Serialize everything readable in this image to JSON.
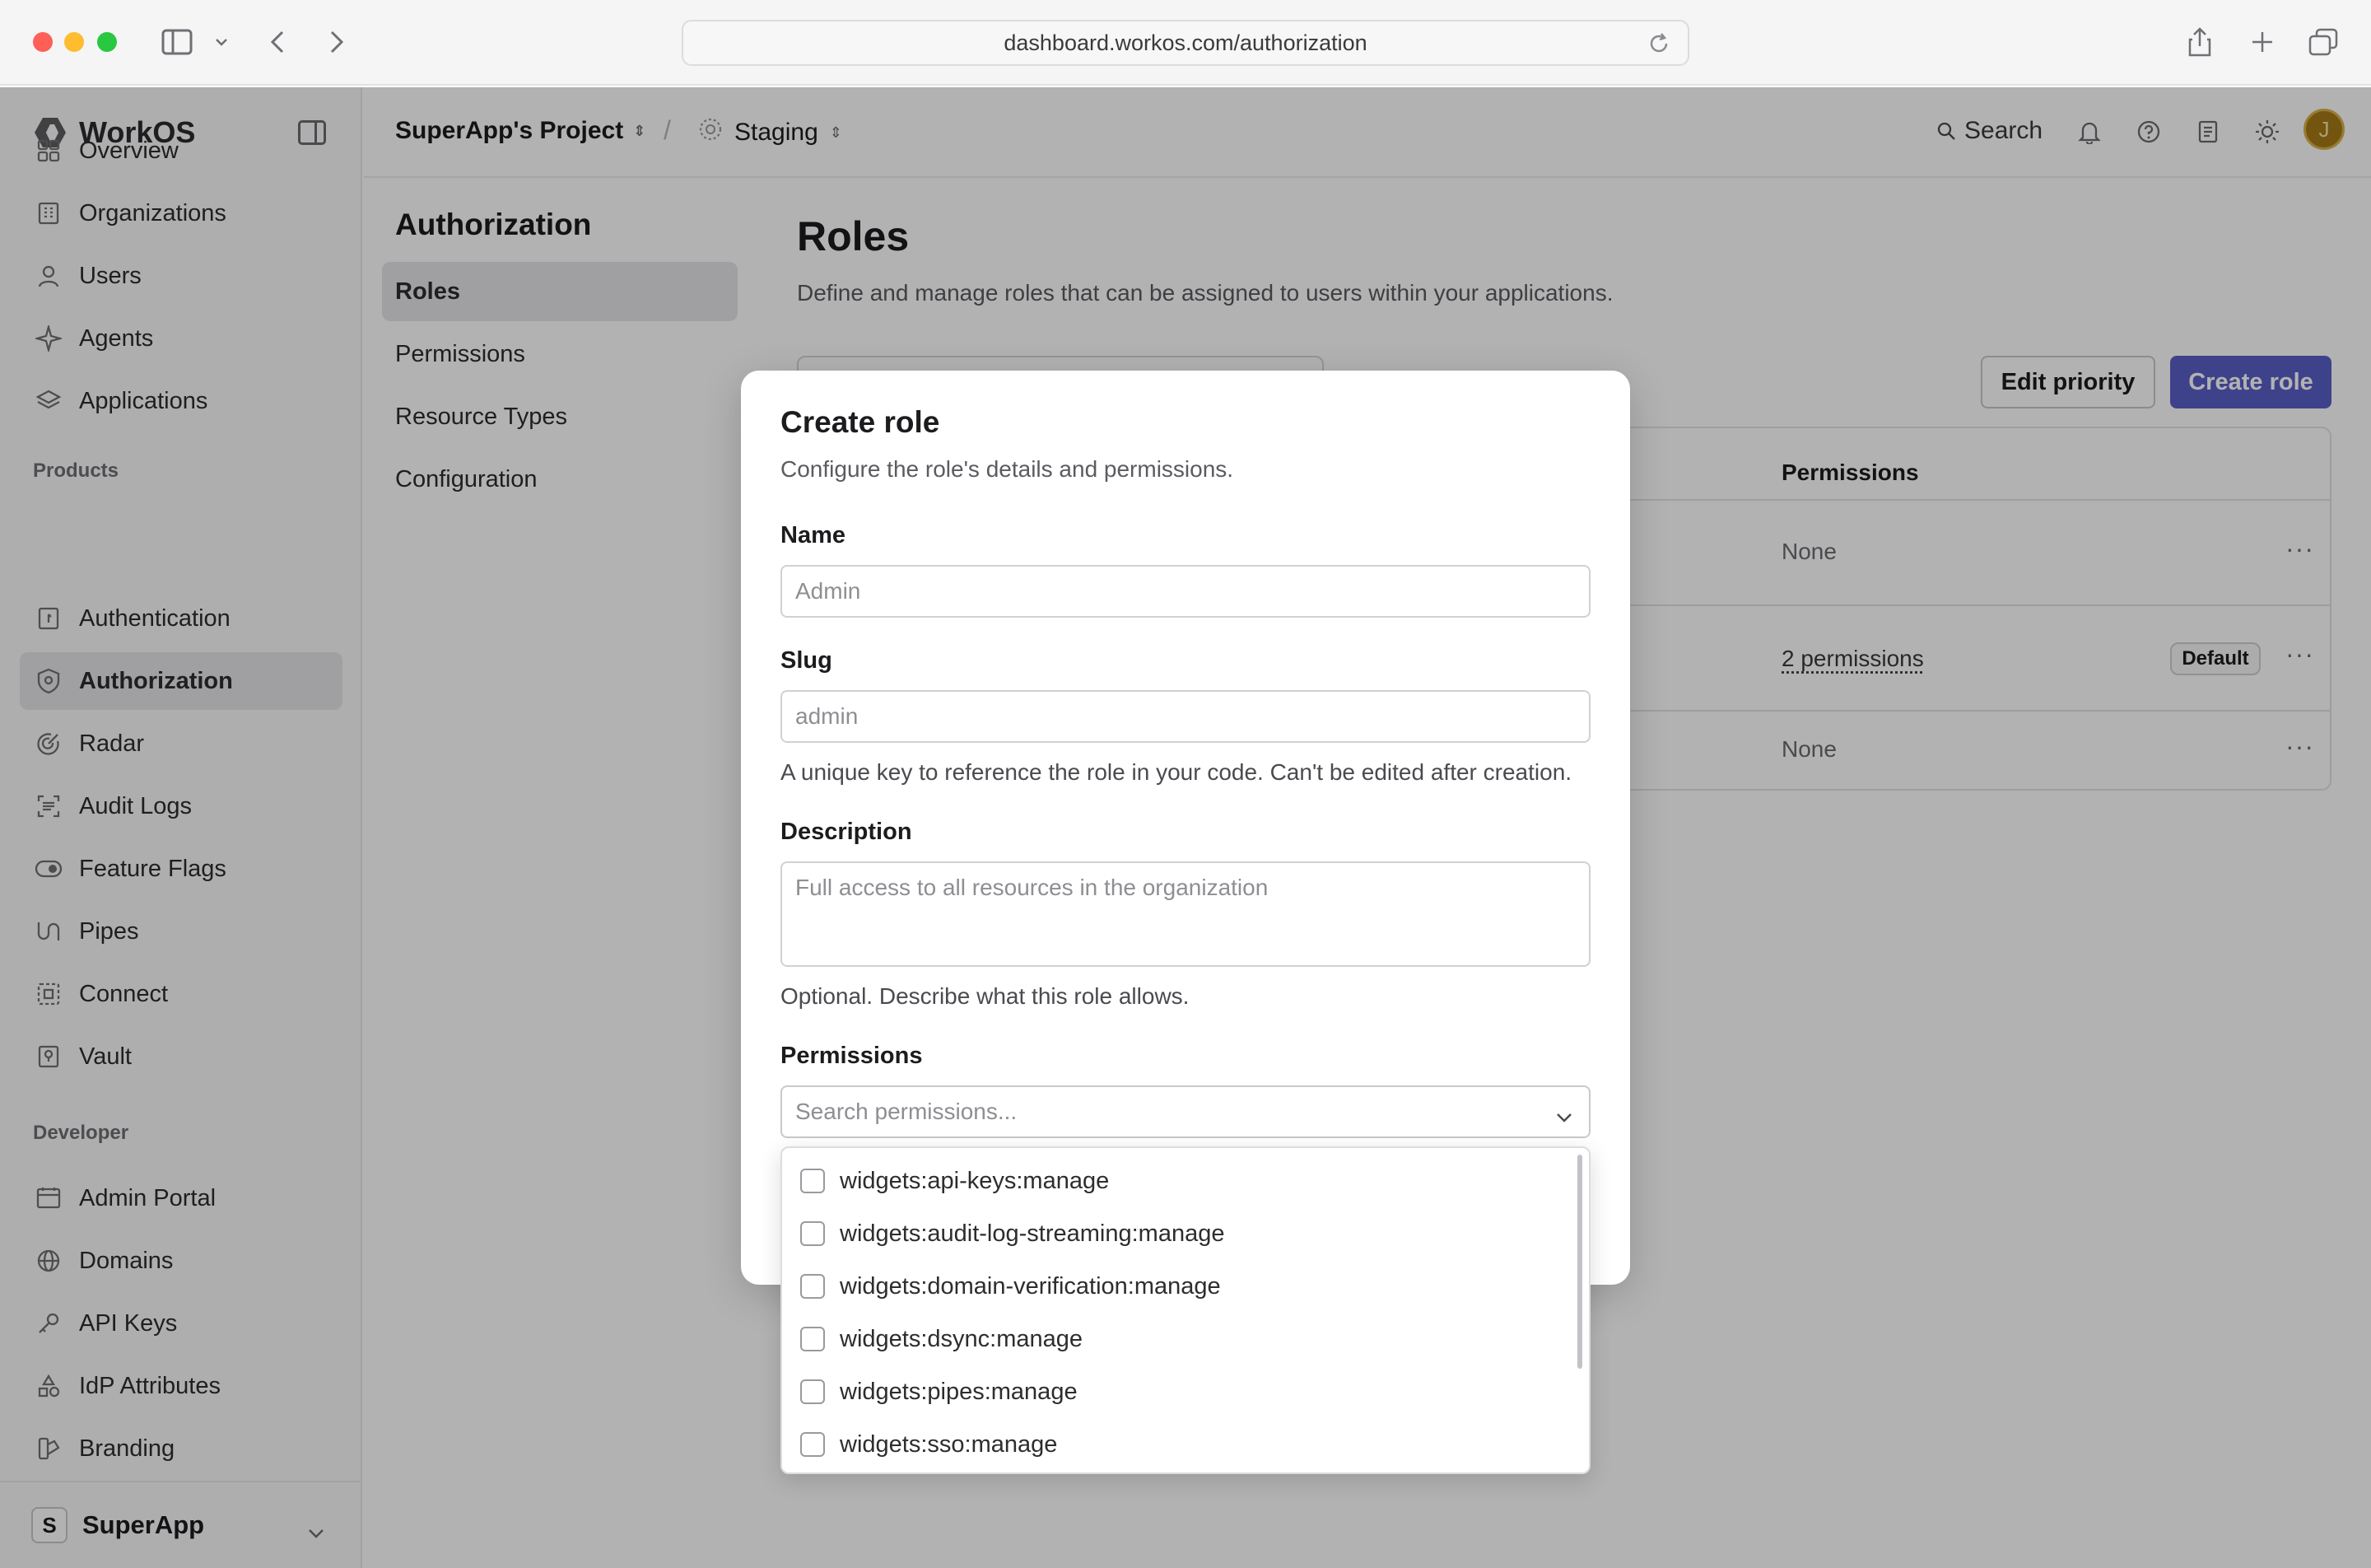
{
  "browser": {
    "url": "dashboard.workos.com/authorization"
  },
  "sidebar": {
    "brand": "WorkOS",
    "items": [
      {
        "label": "Overview",
        "icon": "grid-icon"
      },
      {
        "label": "Organizations",
        "icon": "building-icon"
      },
      {
        "label": "Users",
        "icon": "user-icon"
      },
      {
        "label": "Agents",
        "icon": "sparkle-icon"
      },
      {
        "label": "Applications",
        "icon": "layers-icon"
      }
    ],
    "products_heading": "Products",
    "products": [
      {
        "label": "Authentication",
        "icon": "key-door-icon"
      },
      {
        "label": "Authorization",
        "icon": "shield-icon",
        "active": true
      },
      {
        "label": "Radar",
        "icon": "radar-icon"
      },
      {
        "label": "Audit Logs",
        "icon": "scan-icon"
      },
      {
        "label": "Feature Flags",
        "icon": "toggle-icon"
      },
      {
        "label": "Pipes",
        "icon": "pipes-icon"
      },
      {
        "label": "Connect",
        "icon": "connect-icon"
      },
      {
        "label": "Vault",
        "icon": "vault-icon"
      }
    ],
    "developer_heading": "Developer",
    "developer": [
      {
        "label": "Admin Portal",
        "icon": "calendar-icon"
      },
      {
        "label": "Domains",
        "icon": "globe-icon"
      },
      {
        "label": "API Keys",
        "icon": "key-icon"
      },
      {
        "label": "IdP Attributes",
        "icon": "shapes-icon"
      },
      {
        "label": "Branding",
        "icon": "brush-icon"
      }
    ],
    "workspace": {
      "initial": "S",
      "name": "SuperApp"
    }
  },
  "topbar": {
    "project": "SuperApp's Project",
    "separator": "/",
    "environment": "Staging",
    "search_label": "Search",
    "avatar_initial": "J"
  },
  "subnav": {
    "title": "Authorization",
    "items": [
      "Roles",
      "Permissions",
      "Resource Types",
      "Configuration"
    ]
  },
  "main": {
    "title": "Roles",
    "description": "Define and manage roles that can be assigned to users within your applications.",
    "edit_priority": "Edit priority",
    "create_role": "Create role",
    "table": {
      "permissions_header": "Permissions",
      "rows": [
        {
          "permissions": "None",
          "badge": ""
        },
        {
          "permissions": "2 permissions",
          "badge": "Default"
        },
        {
          "permissions": "None",
          "badge": ""
        }
      ],
      "row_menu": "···"
    }
  },
  "modal": {
    "title": "Create role",
    "subtitle": "Configure the role's details and permissions.",
    "name_label": "Name",
    "name_placeholder": "Admin",
    "slug_label": "Slug",
    "slug_placeholder": "admin",
    "slug_help": "A unique key to reference the role in your code. Can't be edited after creation.",
    "description_label": "Description",
    "description_placeholder": "Full access to all resources in the organization",
    "description_help": "Optional. Describe what this role allows.",
    "permissions_label": "Permissions",
    "permissions_placeholder": "Search permissions...",
    "permission_options": [
      "widgets:api-keys:manage",
      "widgets:audit-log-streaming:manage",
      "widgets:domain-verification:manage",
      "widgets:dsync:manage",
      "widgets:pipes:manage",
      "widgets:sso:manage"
    ]
  },
  "colors": {
    "accent": "#5a5fc8",
    "overlay": "rgba(0,0,0,0.30)"
  }
}
